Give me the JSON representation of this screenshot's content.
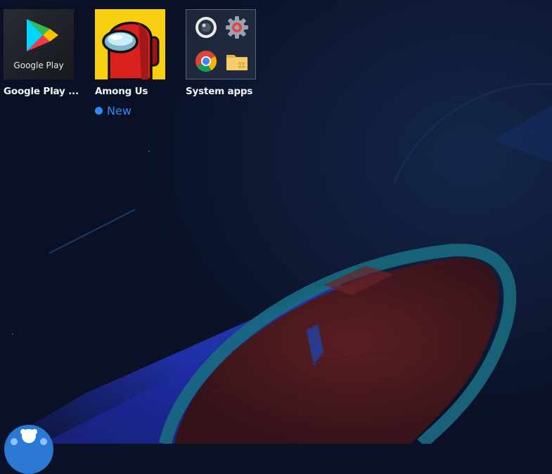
{
  "desktop": {
    "apps": [
      {
        "label": "Google Play ...",
        "icon": "google-play-icon",
        "wordmark": "Google Play"
      },
      {
        "label": "Among Us",
        "icon": "among-us-icon",
        "badge": "New"
      },
      {
        "label": "System apps",
        "icon": "system-apps-folder-icon",
        "contents": [
          "camera-icon",
          "settings-gear-icon",
          "chrome-icon",
          "file-manager-icon"
        ]
      }
    ]
  },
  "assistant": {
    "icon": "assistant-avatar-icon"
  },
  "colors": {
    "background": "#0a1127",
    "badge_blue": "#2d8cf0",
    "among_us_yellow": "#f7cf0e",
    "crewmate_red": "#d9201f"
  }
}
